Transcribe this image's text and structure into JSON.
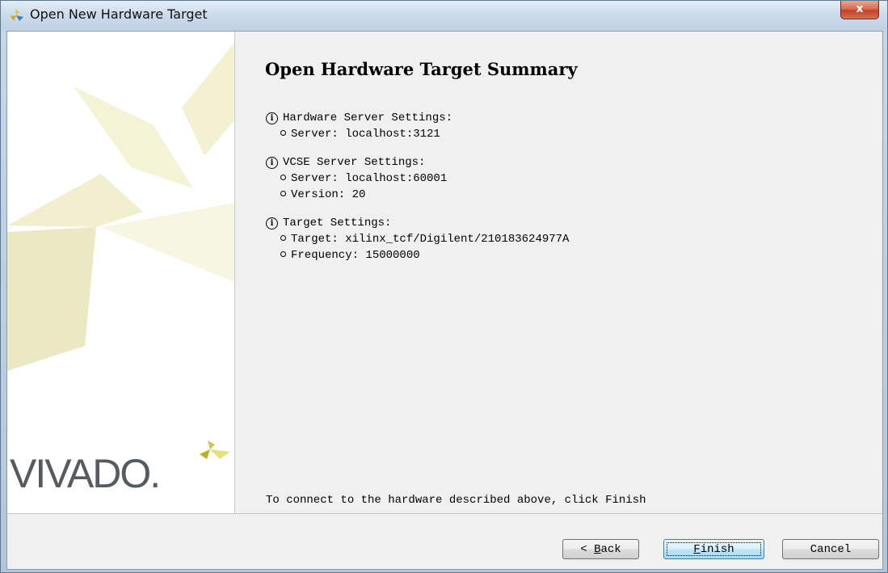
{
  "window": {
    "title": "Open New Hardware Target",
    "close_label": "x",
    "icon": "vivado-logo-icon"
  },
  "left_panel": {
    "brand_text": "VIVADO."
  },
  "summary": {
    "heading": "Open Hardware Target Summary",
    "sections": [
      {
        "icon": "info-icon",
        "title": "Hardware Server Settings:",
        "items": [
          "Server: localhost:3121"
        ]
      },
      {
        "icon": "info-icon",
        "title": "VCSE Server Settings:",
        "items": [
          "Server: localhost:60001",
          "Version: 20"
        ]
      },
      {
        "icon": "info-icon",
        "title": "Target Settings:",
        "items": [
          "Target: xilinx_tcf/Digilent/210183624977A",
          "Frequency: 15000000"
        ]
      }
    ],
    "footer": "To connect to the hardware described above, click Finish"
  },
  "buttons": {
    "back": {
      "prefix": "< ",
      "mnemonic": "B",
      "rest": "ack"
    },
    "finish": {
      "mnemonic": "F",
      "rest": "inish"
    },
    "cancel": "Cancel"
  },
  "colors": {
    "logo_shape": "#f4f2d4",
    "logo_accent": "#c9c84a"
  }
}
